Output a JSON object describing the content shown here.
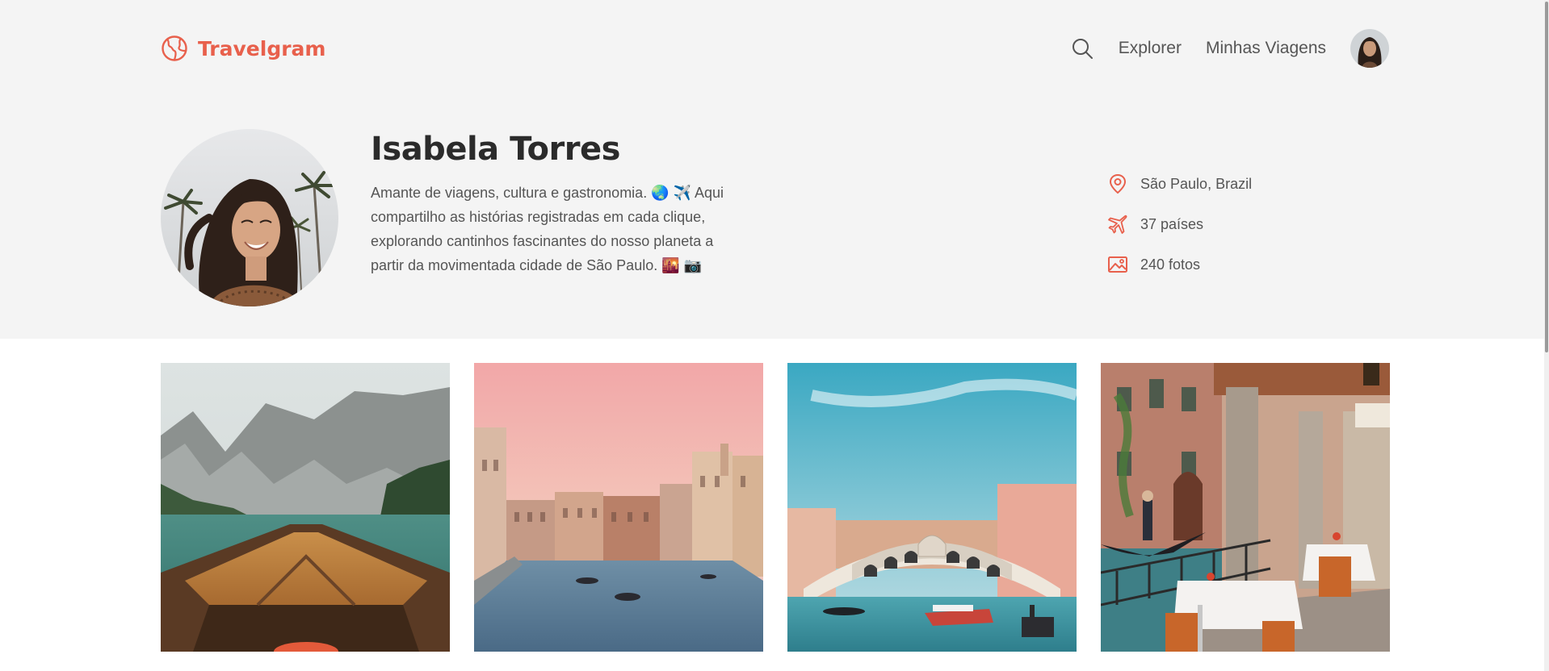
{
  "app": {
    "name": "Travelgram"
  },
  "nav": {
    "explore": "Explorer",
    "my_trips": "Minhas Viagens"
  },
  "profile": {
    "name": "Isabela Torres",
    "bio": "Amante de viagens, cultura e gastronomia. 🌏 ✈️ Aqui compartilho as histórias registradas em cada clique, explorando cantinhos fascinantes do nosso planeta a partir da movimentada cidade de São Paulo. 🌇 📷",
    "location": "São Paulo, Brazil",
    "countries": "37 países",
    "photos": "240 fotos"
  },
  "gallery": [
    "mountain-lake-boat",
    "venice-grand-canal-sunset",
    "rialto-bridge-venice",
    "venice-canal-restaurant"
  ],
  "colors": {
    "accent": "#e8604c",
    "top_band": "#f4f4f4",
    "text_dark": "#2b2b2b",
    "text_muted": "#555555"
  },
  "icons": {
    "logo": "globe-icon",
    "search": "search-icon",
    "location": "map-pin-icon",
    "countries": "plane-icon",
    "photos": "image-icon"
  }
}
